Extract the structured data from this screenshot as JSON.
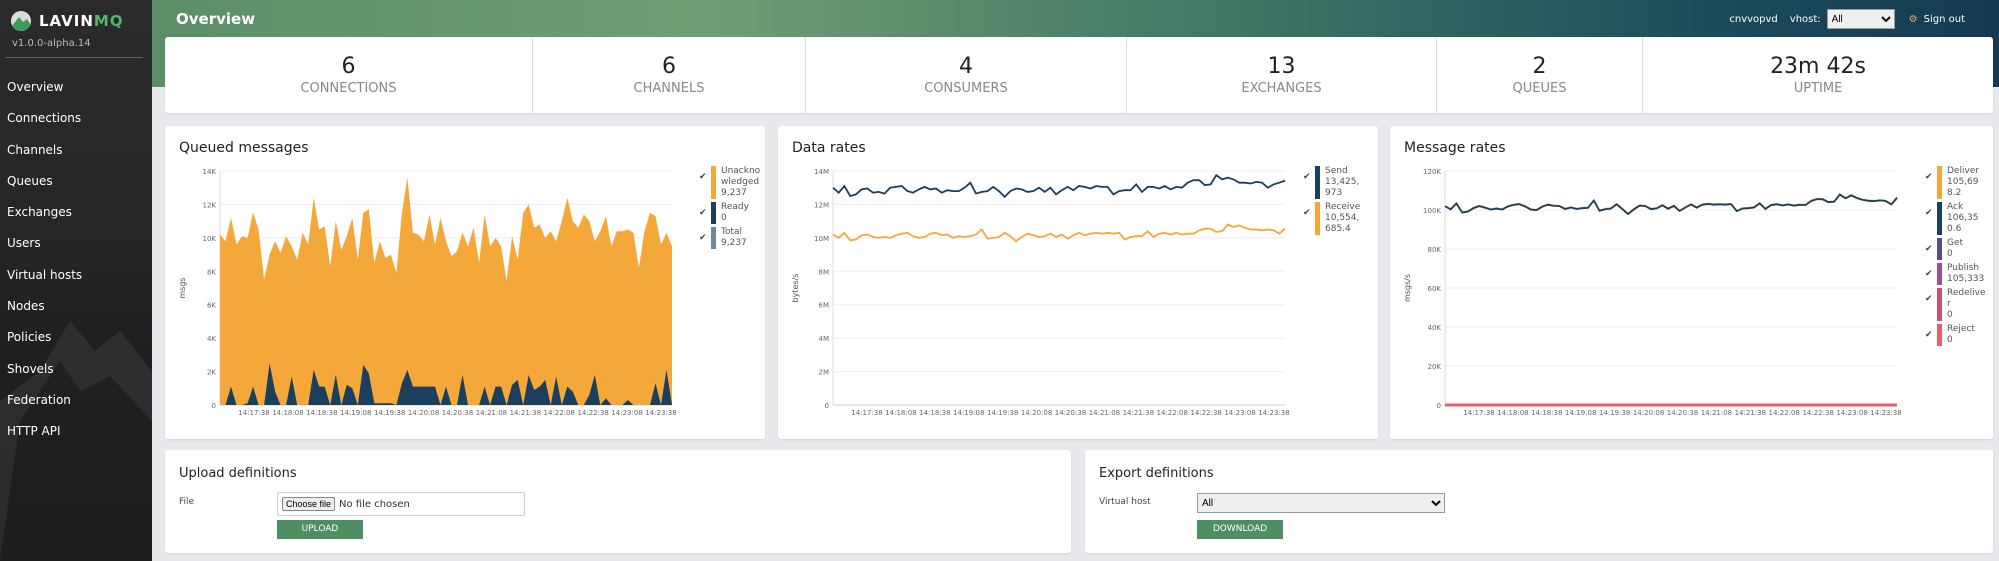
{
  "app": {
    "logo_a": "LAVIN",
    "logo_b": "MQ",
    "version": "v1.0.0-alpha.14",
    "brand_color": "#56b36b"
  },
  "sidebar": {
    "items": [
      {
        "label": "Overview"
      },
      {
        "label": "Connections"
      },
      {
        "label": "Channels"
      },
      {
        "label": "Queues"
      },
      {
        "label": "Exchanges"
      },
      {
        "label": "Users"
      },
      {
        "label": "Virtual hosts"
      },
      {
        "label": "Nodes"
      },
      {
        "label": "Policies"
      },
      {
        "label": "Shovels"
      },
      {
        "label": "Federation"
      },
      {
        "label": "HTTP API"
      }
    ]
  },
  "header": {
    "title": "Overview",
    "user": "cnvvopvd",
    "vhost_label": "vhost:",
    "vhost_value": "All",
    "signout": "Sign out"
  },
  "stats": [
    {
      "value": "6",
      "label": "CONNECTIONS"
    },
    {
      "value": "6",
      "label": "CHANNELS"
    },
    {
      "value": "4",
      "label": "CONSUMERS"
    },
    {
      "value": "13",
      "label": "EXCHANGES"
    },
    {
      "value": "2",
      "label": "QUEUES"
    },
    {
      "value": "23m 42s",
      "label": "UPTIME"
    }
  ],
  "chart_data": [
    {
      "title": "Queued messages",
      "type": "area",
      "ylabel": "msgs",
      "ylim": [
        0,
        14000
      ],
      "yticks": [
        "0",
        "2K",
        "4K",
        "6K",
        "8K",
        "10K",
        "12K",
        "14K"
      ],
      "xticks": [
        "14:17:38",
        "14:18:08",
        "14:18:38",
        "14:19:08",
        "14:19:38",
        "14:20:08",
        "14:20:38",
        "14:21:08",
        "14:21:38",
        "14:22:08",
        "14:22:38",
        "14:23:08",
        "14:23:38"
      ],
      "series": [
        {
          "name": "Unacknowledged",
          "legend": "9,237",
          "color": "#f4a83a",
          "values": [
            10200,
            9800,
            11200,
            9600,
            10100,
            10000,
            11500,
            10500,
            7500,
            9000,
            9800,
            9100,
            10100,
            9500,
            8700,
            10300,
            9600,
            12400,
            10500,
            10700,
            8300,
            11000,
            9300,
            10100,
            11200,
            8700,
            11500,
            11700,
            8500,
            9800,
            8800,
            9000,
            7900,
            11500,
            13600,
            10300,
            10200,
            9800,
            11400,
            9600,
            11200,
            9800,
            8900,
            9200,
            10300,
            9500,
            10600,
            8500,
            11400,
            9500,
            10000,
            9500,
            7400,
            10100,
            8700,
            11500,
            12000,
            10600,
            10800,
            10000,
            10400,
            9800,
            11000,
            12400,
            11000,
            10600,
            11400,
            11000,
            9800,
            10400,
            11300,
            9500,
            10400,
            10400,
            10500,
            10300,
            8200,
            10400,
            11500,
            11300,
            9600,
            10300,
            9500
          ]
        },
        {
          "name": "Ready",
          "legend": "0",
          "color": "#1b3f5e",
          "values": [
            0,
            0,
            1100,
            0,
            0,
            100,
            1100,
            0,
            0,
            2500,
            800,
            0,
            0,
            1700,
            0,
            0,
            0,
            2100,
            1100,
            1100,
            0,
            1800,
            0,
            1200,
            1000,
            0,
            2400,
            1900,
            100,
            100,
            100,
            100,
            0,
            1300,
            2100,
            1100,
            1100,
            1100,
            1100,
            1100,
            0,
            1100,
            0,
            0,
            1800,
            0,
            0,
            0,
            1100,
            0,
            1100,
            1100,
            0,
            1200,
            1500,
            0,
            1800,
            900,
            1100,
            1500,
            0,
            1700,
            0,
            1100,
            800,
            0,
            0,
            600,
            1800,
            0,
            400,
            0,
            0,
            0,
            300,
            0,
            0,
            0,
            0,
            1300,
            0,
            2100,
            0
          ]
        },
        {
          "name": "Total",
          "legend": "9,237",
          "color": "#6e8a99",
          "values": []
        }
      ]
    },
    {
      "title": "Data rates",
      "type": "line",
      "ylabel": "bytes/s",
      "ylim": [
        0,
        14000000
      ],
      "yticks": [
        "0",
        "2M",
        "4M",
        "6M",
        "8M",
        "10M",
        "12M",
        "14M"
      ],
      "xticks": [
        "14:17:38",
        "14:18:08",
        "14:18:38",
        "14:19:08",
        "14:19:38",
        "14:20:08",
        "14:20:38",
        "14:21:08",
        "14:21:38",
        "14:22:08",
        "14:22:38",
        "14:23:08",
        "14:23:38"
      ],
      "series": [
        {
          "name": "Send",
          "legend": "13,425,973",
          "color": "#1b3f5e",
          "values": [
            13000000,
            12700000,
            13100000,
            12500000,
            12600000,
            12900000,
            12950000,
            12700000,
            12750000,
            12650000,
            13000000,
            13050000,
            13100000,
            12800000,
            12700000,
            12900000,
            13050000,
            12900000,
            12950000,
            12700000,
            12850000,
            12800000,
            12800000,
            13000000,
            13300000,
            12650000,
            12750000,
            12800000,
            13050000,
            12800000,
            12450000,
            12800000,
            12950000,
            12900000,
            12750000,
            12800000,
            13000000,
            12750000,
            13000000,
            12600000,
            12850000,
            13050000,
            12850000,
            13100000,
            13050000,
            12950000,
            13100000,
            13050000,
            13050000,
            12600000,
            12800000,
            12850000,
            12850000,
            13200000,
            12750000,
            13050000,
            13050000,
            12950000,
            13100000,
            12900000,
            13050000,
            13000000,
            13300000,
            13450000,
            13450000,
            13150000,
            13200000,
            13750000,
            13500000,
            13600000,
            13500000,
            13300000,
            13300000,
            13250000,
            13350000,
            13300000,
            13000000,
            13200000,
            13300000,
            13425973
          ]
        },
        {
          "name": "Receive",
          "legend": "10,554,685.4",
          "color": "#f4a83a",
          "values": [
            10200000,
            10000000,
            10300000,
            9850000,
            9900000,
            10150000,
            10200000,
            10050000,
            10000000,
            10050000,
            10000000,
            10150000,
            10250000,
            10300000,
            10100000,
            10000000,
            10050000,
            10250000,
            10300000,
            10150000,
            10200000,
            10000000,
            10100000,
            10050000,
            10100000,
            10200000,
            10500000,
            9950000,
            10000000,
            10050000,
            10300000,
            10100000,
            9800000,
            10050000,
            10250000,
            10150000,
            10050000,
            10100000,
            10250000,
            10050000,
            10200000,
            9950000,
            10150000,
            10300000,
            10150000,
            10250000,
            10300000,
            10250000,
            10300000,
            10250000,
            10300000,
            9900000,
            10050000,
            10100000,
            10100000,
            10400000,
            10050000,
            10250000,
            10300000,
            10200000,
            10300000,
            10200000,
            10250000,
            10250000,
            10450000,
            10550000,
            10550000,
            10350000,
            10400000,
            10800000,
            10650000,
            10750000,
            10600000,
            10500000,
            10500000,
            10450000,
            10500000,
            10450000,
            10250000,
            10554685
          ]
        }
      ]
    },
    {
      "title": "Message rates",
      "type": "line",
      "ylabel": "msgs/s",
      "ylim": [
        0,
        120000
      ],
      "yticks": [
        "0",
        "20K",
        "40K",
        "60K",
        "80K",
        "100K",
        "120K"
      ],
      "xticks": [
        "14:17:38",
        "14:18:08",
        "14:18:38",
        "14:19:08",
        "14:19:38",
        "14:20:08",
        "14:20:38",
        "14:21:08",
        "14:21:38",
        "14:22:08",
        "14:22:38",
        "14:23:08",
        "14:23:38"
      ],
      "series": [
        {
          "name": "Deliver",
          "legend": "105,698.2",
          "color": "#f4a83a",
          "values": [
            102000,
            100500,
            103500,
            98800,
            99400,
            101200,
            102200,
            101400,
            100400,
            100900,
            100400,
            102000,
            102800,
            103200,
            102000,
            100400,
            100100,
            101900,
            102900,
            102300,
            102200,
            100700,
            101500,
            100700,
            101100,
            101300,
            105000,
            99800,
            100600,
            100900,
            103100,
            100600,
            98100,
            100500,
            102400,
            102200,
            100600,
            101000,
            102600,
            100800,
            102300,
            99700,
            101500,
            103000,
            101400,
            102900,
            103300,
            102900,
            103100,
            102900,
            103200,
            99600,
            100900,
            101100,
            101500,
            103600,
            100700,
            102700,
            103100,
            102500,
            103000,
            102400,
            102800,
            102700,
            104800,
            105800,
            105700,
            104200,
            104400,
            108100,
            106200,
            107700,
            106300,
            105400,
            104900,
            104700,
            105100,
            104800,
            103000,
            105698
          ]
        },
        {
          "name": "Ack",
          "legend": "106,350.6",
          "color": "#1b3f5e",
          "values": [
            102000,
            100300,
            103300,
            98700,
            99200,
            101000,
            102000,
            101200,
            100200,
            100700,
            100200,
            101800,
            102600,
            103000,
            101800,
            100200,
            99900,
            101700,
            102700,
            102100,
            102000,
            100500,
            101300,
            100500,
            100900,
            101100,
            104800,
            99600,
            100400,
            100700,
            102900,
            100400,
            97900,
            100300,
            102200,
            102000,
            100400,
            100800,
            102400,
            100600,
            102100,
            99500,
            101300,
            102800,
            101200,
            102700,
            103100,
            102700,
            102900,
            102700,
            103000,
            99400,
            100700,
            100900,
            101300,
            103400,
            100500,
            102500,
            102900,
            102300,
            102800,
            102200,
            102600,
            102500,
            104600,
            105600,
            105500,
            104000,
            104200,
            107900,
            106000,
            107500,
            106100,
            105200,
            104700,
            104500,
            104900,
            104600,
            102800,
            106350
          ]
        },
        {
          "name": "Get",
          "legend": "0",
          "color": "#5a4a8f",
          "values": [
            0,
            0
          ]
        },
        {
          "name": "Publish",
          "legend": "105,333",
          "color": "#9b4f96",
          "values": [
            0,
            0
          ]
        },
        {
          "name": "Redeliver",
          "legend": "0",
          "color": "#c9507a",
          "values": [
            0,
            0
          ]
        },
        {
          "name": "Reject",
          "legend": "0",
          "color": "#e8606a",
          "values": [
            0,
            0
          ]
        }
      ]
    }
  ],
  "upload": {
    "title": "Upload definitions",
    "file_label": "File",
    "choose_label": "Choose file",
    "no_file": "No file chosen",
    "button": "UPLOAD"
  },
  "export": {
    "title": "Export definitions",
    "vhost_label": "Virtual host",
    "vhost_value": "All",
    "button": "DOWNLOAD"
  }
}
